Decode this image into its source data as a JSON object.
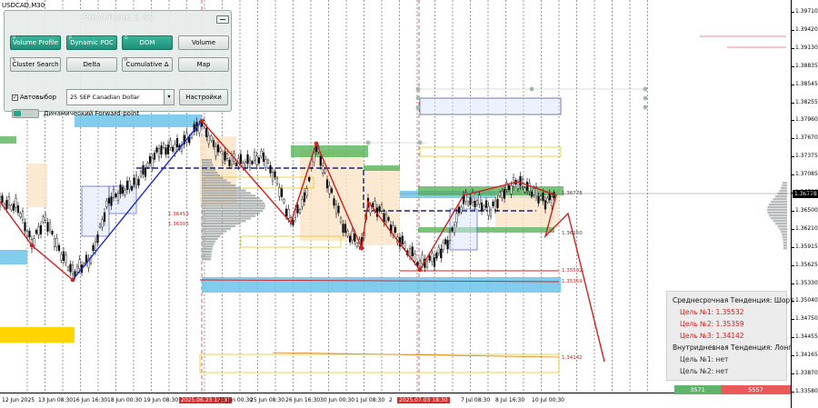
{
  "window": {
    "symbol_tag": "USDCAD,M30"
  },
  "panel": {
    "title": "ProVolume 2.07",
    "buttons": [
      {
        "label": "Volume Profile",
        "active": true
      },
      {
        "label": "Dynamic POC",
        "active": true
      },
      {
        "label": "DOM",
        "active": true
      },
      {
        "label": "Volume",
        "active": false
      },
      {
        "label": "Cluster Search",
        "active": false
      },
      {
        "label": "Delta",
        "active": false
      },
      {
        "label": "Cumulative Δ",
        "active": false
      },
      {
        "label": "Map",
        "active": false
      }
    ],
    "checkbox_label": "Автовыбор",
    "instrument": "25 SEP Canadian Dollar",
    "settings_label": "Настройки",
    "toggle_label": "Динамический Forward-point"
  },
  "price_axis": {
    "labels": [
      "1.39710",
      "1.39420",
      "1.39130",
      "1.38835",
      "1.38545",
      "1.38255",
      "1.37960",
      "1.37670",
      "1.37375",
      "1.37085",
      "1.36795",
      "1.36500",
      "1.36210",
      "1.35915",
      "1.35625",
      "1.35330",
      "1.35040",
      "1.34750",
      "1.34455",
      "1.34165",
      "1.33870",
      "1.33580"
    ],
    "current": "1.36778"
  },
  "time_axis": {
    "labels": [
      "12 Jun 2025",
      "13 Jun 08:30",
      "16 Jun 16:30",
      "18 Jun 00:30",
      "19 Jun 08:30",
      "2025.06.23 12:00",
      "24 Jun 00:30",
      "25 Jun 08:30",
      "26 Jun 16:30",
      "30 Jun 00:30",
      "1 Jul 08:30",
      "2",
      "2025.07.03 18:30",
      "7 Jul 08:30",
      "8 Jul 16:30",
      "10 Jul 00:30"
    ]
  },
  "levels": {
    "l1": "1.36778",
    "l2": "1.36453",
    "l3": "1.36305",
    "l4": "1.36150",
    "l5": "1.35532",
    "l6": "1.35359",
    "l7": "1.34142"
  },
  "trend": {
    "medium_header": "Среднесрочная Тенденция: Шорт",
    "medium_targets": [
      "Цель №1: 1.35532",
      "Цель №2: 1.35359",
      "Цель №3: 1.34142"
    ],
    "intraday_header": "Внутридневная Тенденция: Лонг",
    "intraday_targets": [
      "Цель №1: нет",
      "Цель №2: нет"
    ]
  },
  "volume_bar": {
    "buy": "3571",
    "sell": "5557"
  },
  "colors": {
    "up_trend": "#1a2fd6",
    "down_trend": "#d41c1c",
    "active_button": "#1f8f78",
    "zone_blue": "#6cc3ea",
    "zone_yellow": "#ffd400",
    "zone_green": "#4caf50"
  }
}
